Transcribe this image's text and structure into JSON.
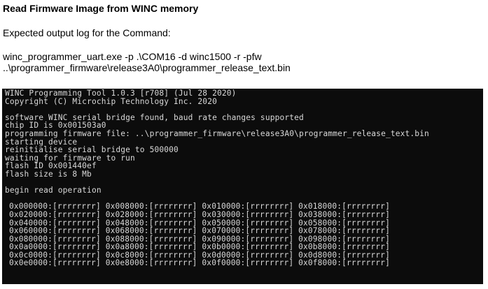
{
  "document": {
    "heading": "Read Firmware Image from WINC memory",
    "subtitle": "Expected output log for the Command:",
    "command_line1": "winc_programmer_uart.exe -p .\\COM16 -d winc1500 -r -pfw",
    "command_line2": "..\\programmer_firmware\\release3A0\\programmer_release_text.bin"
  },
  "console": {
    "header": [
      "WINC Programming Tool 1.0.3 [r708] (Jul 28 2020)",
      "Copyright (C) Microchip Technology Inc. 2020"
    ],
    "log": [
      "software WINC serial bridge found, baud rate changes supported",
      "chip ID is 0x001503a0",
      "programming firmware file: ..\\programmer_firmware\\release3A0\\programmer_release_text.bin",
      "starting device",
      "reinitialise serial bridge to 500000",
      "waiting for firmware to run",
      "flash ID 0x001440ef",
      "flash size is 8 Mb"
    ],
    "read_start": "begin read operation",
    "memory": [
      "0x000000:[rrrrrrrr] 0x008000:[rrrrrrrr] 0x010000:[rrrrrrrr] 0x018000:[rrrrrrrr]",
      "0x020000:[rrrrrrrr] 0x028000:[rrrrrrrr] 0x030000:[rrrrrrrr] 0x038000:[rrrrrrrr]",
      "0x040000:[rrrrrrrr] 0x048000:[rrrrrrrr] 0x050000:[rrrrrrrr] 0x058000:[rrrrrrrr]",
      "0x060000:[rrrrrrrr] 0x068000:[rrrrrrrr] 0x070000:[rrrrrrrr] 0x078000:[rrrrrrrr]",
      "0x080000:[rrrrrrrr] 0x088000:[rrrrrrrr] 0x090000:[rrrrrrrr] 0x098000:[rrrrrrrr]",
      "0x0a0000:[rrrrrrrr] 0x0a8000:[rrrrrrrr] 0x0b0000:[rrrrrrrr] 0x0b8000:[rrrrrrrr]",
      "0x0c0000:[rrrrrrrr] 0x0c8000:[rrrrrrrr] 0x0d0000:[rrrrrrrr] 0x0d8000:[rrrrrrrr]",
      "0x0e0000:[rrrrrrrr] 0x0e8000:[rrrrrrrr] 0x0f0000:[rrrrrrrr] 0x0f8000:[rrrrrrrr]"
    ]
  },
  "colors": {
    "console_background": "#0c0c0c",
    "console_text": "#d9d9d9",
    "page_background": "#ffffff"
  }
}
